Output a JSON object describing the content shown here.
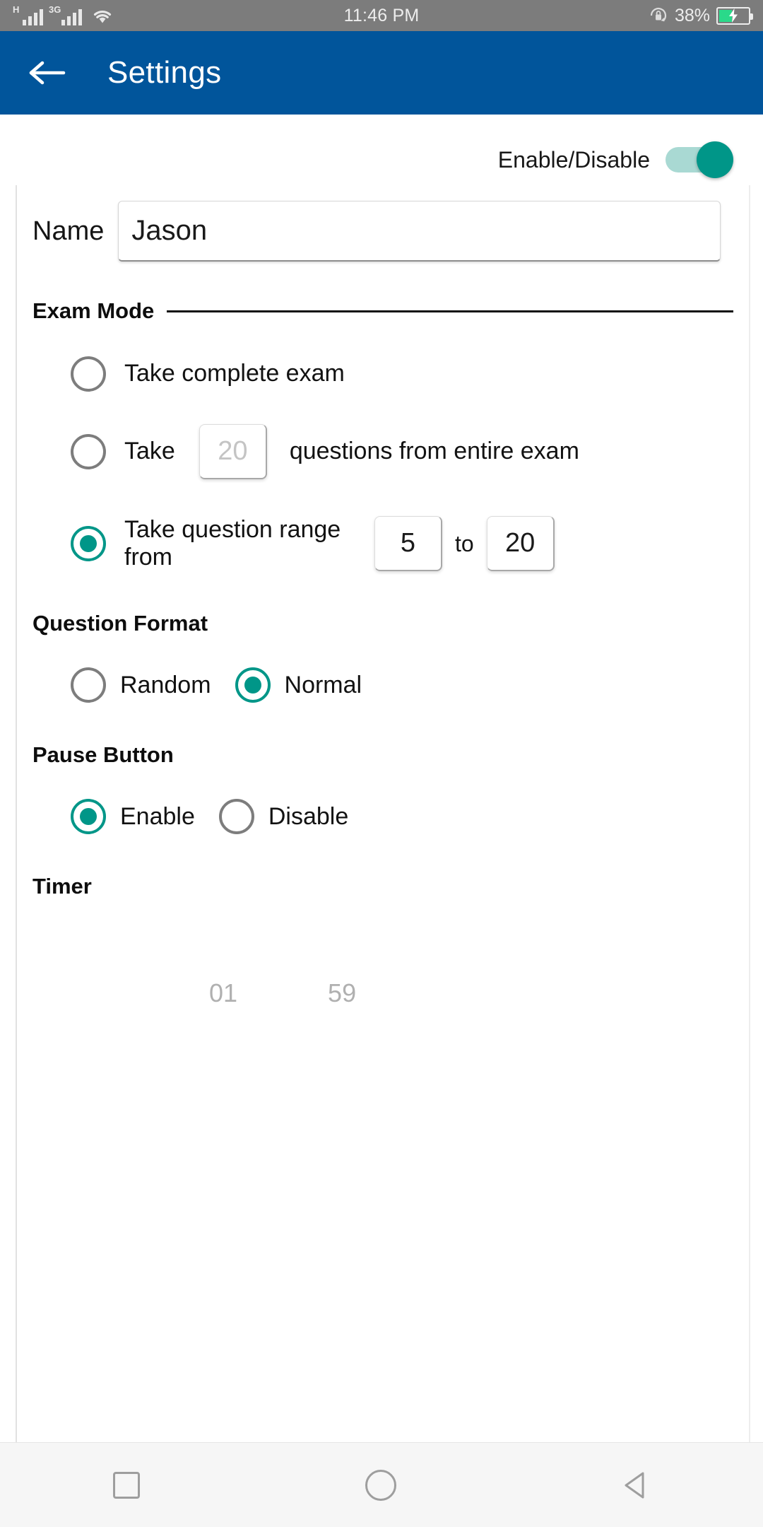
{
  "status_bar": {
    "sim1_network": "H",
    "sim2_network": "3G",
    "wifi_icon": "wifi-icon",
    "time": "11:46 PM",
    "rotation_lock_icon": "rotation-lock-icon",
    "battery_percent": "38%",
    "battery_icon": "battery-charging-icon"
  },
  "app_bar": {
    "back_icon": "back-arrow-icon",
    "title": "Settings"
  },
  "enable_disable": {
    "label": "Enable/Disable",
    "state": "on"
  },
  "name_field": {
    "label": "Name",
    "value": "Jason"
  },
  "exam_mode": {
    "legend": "Exam Mode",
    "options": [
      {
        "label": "Take complete exam",
        "selected": false
      },
      {
        "label": "Take",
        "count_placeholder": "20",
        "suffix": "questions from entire exam",
        "selected": false
      },
      {
        "label": "Take question range from",
        "from_value": "5",
        "to_word": "to",
        "to_value": "20",
        "selected": true
      }
    ]
  },
  "question_format": {
    "heading": "Question Format",
    "options": [
      {
        "label": "Random",
        "selected": false
      },
      {
        "label": "Normal",
        "selected": true
      }
    ]
  },
  "pause_button": {
    "heading": "Pause Button",
    "options": [
      {
        "label": "Enable",
        "selected": true
      },
      {
        "label": "Disable",
        "selected": false
      }
    ]
  },
  "timer": {
    "heading": "Timer",
    "minutes": "01",
    "seconds": "59"
  },
  "nav_bar": {
    "recents_icon": "square-recents-icon",
    "home_icon": "circle-home-icon",
    "back_icon": "triangle-back-icon"
  },
  "colors": {
    "app_bar": "#01559b",
    "accent_teal": "#009688",
    "status_bar": "#7c7c7c",
    "battery_green": "#2ad98a"
  }
}
